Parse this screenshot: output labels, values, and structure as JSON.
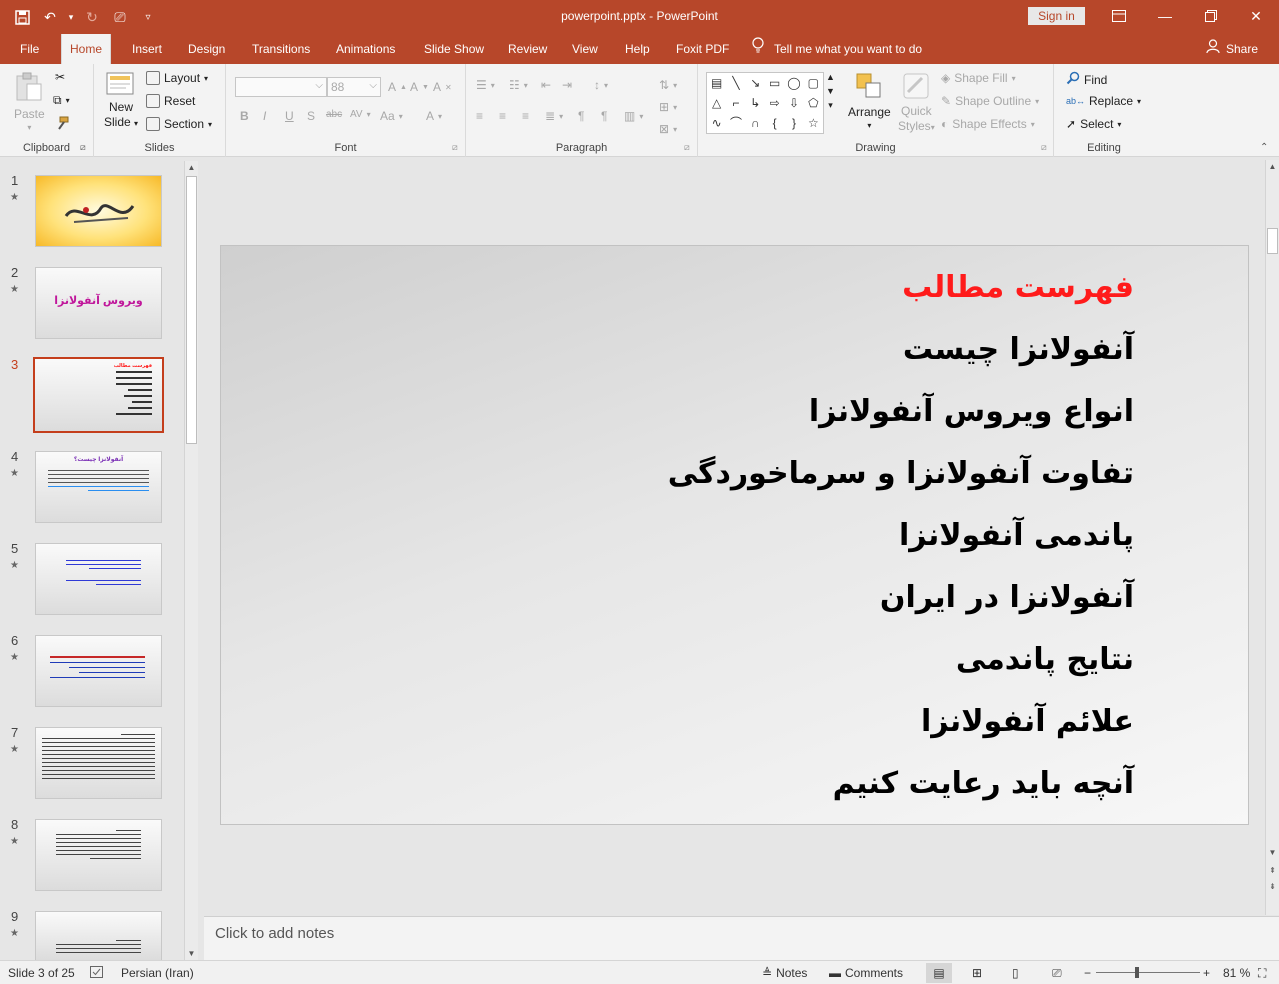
{
  "window": {
    "title": "powerpoint.pptx  -  PowerPoint",
    "signin": "Sign in"
  },
  "tabs": [
    "File",
    "Home",
    "Insert",
    "Design",
    "Transitions",
    "Animations",
    "Slide Show",
    "Review",
    "View",
    "Help",
    "Foxit PDF"
  ],
  "tellme": "Tell me what you want to do",
  "share": "Share",
  "ribbon": {
    "clipboard": {
      "paste": "Paste",
      "label": "Clipboard"
    },
    "slides": {
      "new_slide_1": "New",
      "new_slide_2": "Slide",
      "layout": "Layout",
      "reset": "Reset",
      "section": "Section",
      "label": "Slides"
    },
    "font": {
      "size": "88",
      "bold": "B",
      "italic": "I",
      "underline": "U",
      "shadow": "S",
      "strike": "abc",
      "spacing": "AV",
      "case": "Aa",
      "color": "A",
      "label": "Font"
    },
    "paragraph": {
      "label": "Paragraph"
    },
    "drawing": {
      "arrange": "Arrange",
      "quick_styles_1": "Quick",
      "quick_styles_2": "Styles",
      "shape_fill": "Shape Fill",
      "shape_outline": "Shape Outline",
      "shape_effects": "Shape Effects",
      "label": "Drawing"
    },
    "editing": {
      "find": "Find",
      "replace": "Replace",
      "select": "Select",
      "label": "Editing"
    }
  },
  "thumbnails": [
    {
      "num": "1",
      "text": ""
    },
    {
      "num": "2",
      "text": "ویروس آنفولانزا"
    },
    {
      "num": "3",
      "text": "فهرست مطالب"
    },
    {
      "num": "4",
      "text": "آنفولانزا چیست؟"
    },
    {
      "num": "5",
      "text": ""
    },
    {
      "num": "6",
      "text": ""
    },
    {
      "num": "7",
      "text": ""
    },
    {
      "num": "8",
      "text": ""
    },
    {
      "num": "9",
      "text": ""
    }
  ],
  "slide": {
    "title": "فهرست مطالب",
    "items": [
      "آنفولانزا چیست",
      "انواع ویروس آنفولانزا",
      "تفاوت آنفولانزا و سرماخوردگی",
      "پاندمی آنفولانزا",
      "آنفولانزا در ایران",
      "نتایج پاندمی",
      "علائم آنفولانزا",
      "آنچه باید رعایت کنیم"
    ],
    "colors": {
      "title": "#ff1b1b",
      "text": "#000000"
    }
  },
  "notes": {
    "placeholder": "Click to add notes"
  },
  "status": {
    "slide": "Slide 3 of 25",
    "language": "Persian (Iran)",
    "notes": "Notes",
    "comments": "Comments",
    "zoom": "81 %"
  },
  "accent": "#b7472a"
}
